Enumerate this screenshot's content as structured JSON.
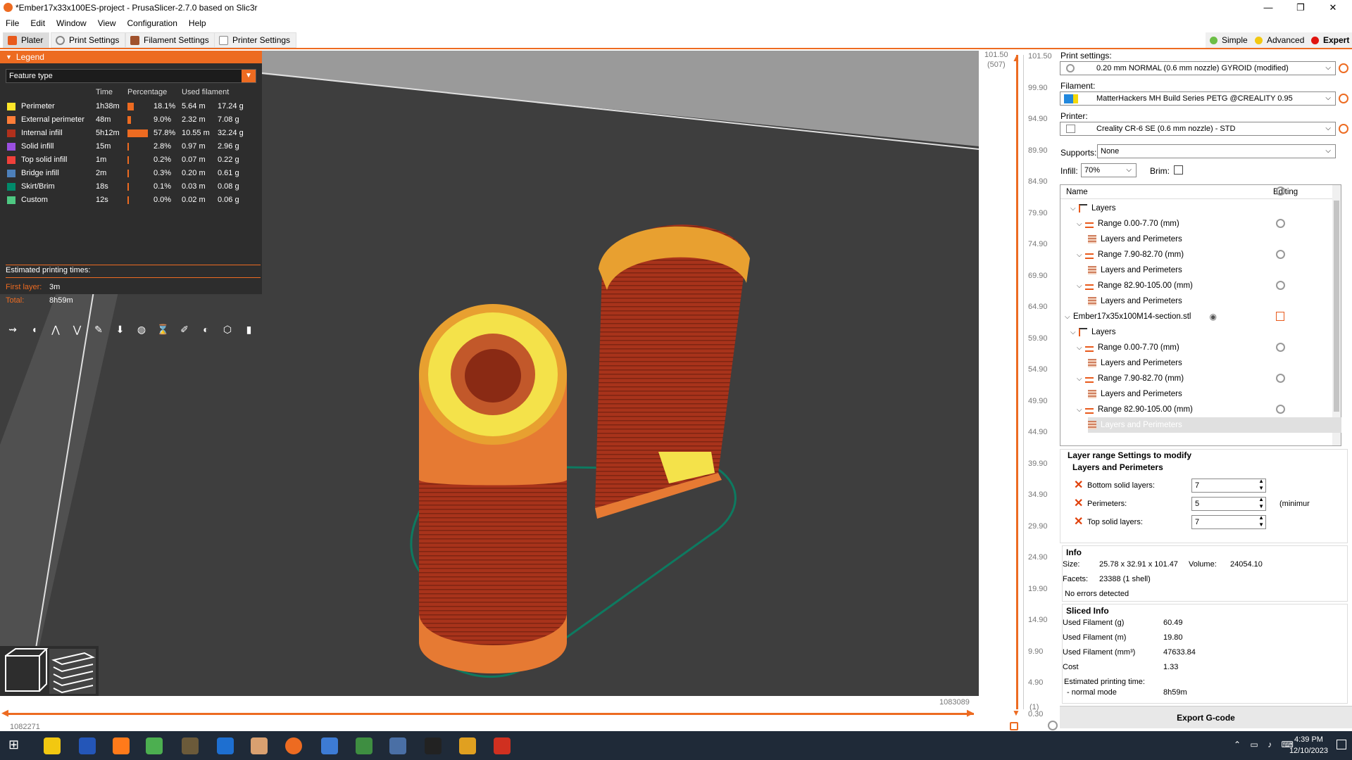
{
  "window": {
    "title": "*Ember17x33x100ES-project - PrusaSlicer-2.7.0 based on Slic3r",
    "minimize": "—",
    "maximize": "❐",
    "close": "✕"
  },
  "menu": [
    "File",
    "Edit",
    "Window",
    "View",
    "Configuration",
    "Help"
  ],
  "tabs": [
    {
      "label": "Plater",
      "icon": "plater-icon"
    },
    {
      "label": "Print Settings",
      "icon": "print-settings-icon"
    },
    {
      "label": "Filament Settings",
      "icon": "filament-icon"
    },
    {
      "label": "Printer Settings",
      "icon": "printer-icon"
    }
  ],
  "modes": [
    {
      "label": "Simple",
      "color": "#6cbe45"
    },
    {
      "label": "Advanced",
      "color": "#f2c811"
    },
    {
      "label": "Expert",
      "color": "#e0140f"
    }
  ],
  "legend": {
    "header": "Legend",
    "view_type": "Feature type",
    "columns": {
      "time": "Time",
      "percentage": "Percentage",
      "used": "Used filament"
    },
    "rows": [
      {
        "name": "Perimeter",
        "time": "1h38m",
        "pct": "18.1%",
        "pct_value": 18.1,
        "len": "5.64 m",
        "weight": "17.24 g",
        "color": "#ffe629"
      },
      {
        "name": "External perimeter",
        "time": "48m",
        "pct": "9.0%",
        "pct_value": 9.0,
        "len": "2.32 m",
        "weight": "7.08 g",
        "color": "#ff7d38"
      },
      {
        "name": "Internal infill",
        "time": "5h12m",
        "pct": "57.8%",
        "pct_value": 57.8,
        "len": "10.55 m",
        "weight": "32.24 g",
        "color": "#b0301c"
      },
      {
        "name": "Solid infill",
        "time": "15m",
        "pct": "2.8%",
        "pct_value": 2.8,
        "len": "0.97 m",
        "weight": "2.96 g",
        "color": "#9a4fe0"
      },
      {
        "name": "Top solid infill",
        "time": "1m",
        "pct": "0.2%",
        "pct_value": 0.2,
        "len": "0.07 m",
        "weight": "0.22 g",
        "color": "#f0403a"
      },
      {
        "name": "Bridge infill",
        "time": "2m",
        "pct": "0.3%",
        "pct_value": 0.3,
        "len": "0.20 m",
        "weight": "0.61 g",
        "color": "#4d80ba"
      },
      {
        "name": "Skirt/Brim",
        "time": "18s",
        "pct": "0.1%",
        "pct_value": 0.1,
        "len": "0.03 m",
        "weight": "0.08 g",
        "color": "#008a6a"
      },
      {
        "name": "Custom",
        "time": "12s",
        "pct": "0.0%",
        "pct_value": 0.0,
        "len": "0.02 m",
        "weight": "0.06 g",
        "color": "#4ec882"
      }
    ],
    "est_label": "Estimated printing times:",
    "first_layer_label": "First layer:",
    "first_layer": "3m",
    "total_label": "Total:",
    "total": "8h59m",
    "view_icons": [
      "travel-icon",
      "wipe-icon",
      "retraction-icon",
      "deretraction-icon",
      "seam-icon",
      "tool-change-icon",
      "color-change-icon",
      "pause-icon",
      "custom-gcode-icon",
      "center-of-gravity-icon",
      "shells-icon",
      "tool-marker-icon"
    ]
  },
  "vslider": {
    "top": "101.50",
    "top_layer": "(507)",
    "bottom": "0.30",
    "bottom_layer": "(1)",
    "ticks": [
      "101.50",
      "99.90",
      "94.90",
      "89.90",
      "84.90",
      "79.90",
      "74.90",
      "69.90",
      "64.90",
      "59.90",
      "54.90",
      "49.90",
      "44.90",
      "39.90",
      "34.90",
      "29.90",
      "24.90",
      "19.90",
      "14.90",
      "9.90",
      "4.90",
      "0.30"
    ]
  },
  "hslider": {
    "left": "1082271",
    "right": "1083089"
  },
  "panel": {
    "print_label": "Print settings:",
    "print_value": "0.20 mm NORMAL (0.6 mm nozzle) GYROID (modified)",
    "filament_label": "Filament:",
    "filament_value": "MatterHackers MH Build Series PETG @CREALITY 0.95",
    "printer_label": "Printer:",
    "printer_value": "Creality CR-6 SE (0.6 mm nozzle) - STD",
    "supports_label": "Supports:",
    "supports_value": "None",
    "infill_label": "Infill:",
    "infill_value": "70%",
    "brim_label": "Brim:"
  },
  "tree": {
    "col_name": "Name",
    "col_editing": "Editing",
    "rows": [
      {
        "label": "Layers",
        "indent": 1,
        "kind": "layers"
      },
      {
        "label": "Range 0.00-7.70 (mm)",
        "indent": 2,
        "kind": "range"
      },
      {
        "label": "Layers and Perimeters",
        "indent": 3,
        "kind": "setting"
      },
      {
        "label": "Range 7.90-82.70 (mm)",
        "indent": 2,
        "kind": "range"
      },
      {
        "label": "Layers and Perimeters",
        "indent": 3,
        "kind": "setting"
      },
      {
        "label": "Range 82.90-105.00 (mm)",
        "indent": 2,
        "kind": "range"
      },
      {
        "label": "Layers and Perimeters",
        "indent": 3,
        "kind": "setting"
      },
      {
        "label": "Ember17x35x100M14-section.stl",
        "indent": 0,
        "kind": "object"
      },
      {
        "label": "Layers",
        "indent": 1,
        "kind": "layers"
      },
      {
        "label": "Range 0.00-7.70 (mm)",
        "indent": 2,
        "kind": "range"
      },
      {
        "label": "Layers and Perimeters",
        "indent": 3,
        "kind": "setting"
      },
      {
        "label": "Range 7.90-82.70 (mm)",
        "indent": 2,
        "kind": "range"
      },
      {
        "label": "Layers and Perimeters",
        "indent": 3,
        "kind": "setting"
      },
      {
        "label": "Range 82.90-105.00 (mm)",
        "indent": 2,
        "kind": "range"
      },
      {
        "label": "Layers and Perimeters",
        "indent": 3,
        "kind": "setting-selected"
      }
    ]
  },
  "layer_settings": {
    "title": "Layer range Settings to modify",
    "subtitle": "Layers and Perimeters",
    "fields": [
      {
        "label": "Bottom solid layers:",
        "value": "7",
        "suffix": ""
      },
      {
        "label": "Perimeters:",
        "value": "5",
        "suffix": "(minimur"
      },
      {
        "label": "Top solid layers:",
        "value": "7",
        "suffix": ""
      }
    ]
  },
  "info": {
    "title": "Info",
    "size_label": "Size:",
    "size": "25.78 x 32.91 x 101.47",
    "volume_label": "Volume:",
    "volume": "24054.10",
    "facets_label": "Facets:",
    "facets": "23388 (1 shell)",
    "errors": "No errors detected"
  },
  "sliced": {
    "title": "Sliced Info",
    "rows": [
      {
        "label": "Used Filament (g)",
        "value": "60.49"
      },
      {
        "label": "Used Filament (m)",
        "value": "19.80"
      },
      {
        "label": "Used Filament (mm³)",
        "value": "47633.84"
      },
      {
        "label": "Cost",
        "value": "1.33"
      }
    ],
    "est_label": "Estimated printing time:",
    "mode_label": "- normal mode",
    "mode_value": "8h59m"
  },
  "export_button": "Export G-code",
  "taskbar": {
    "time": "4:39 PM",
    "date": "12/10/2023",
    "apps": [
      "windows-start-icon",
      "file-explorer-icon",
      "powershell-icon",
      "firefox-icon",
      "notepad-icon",
      "gimp-icon",
      "app-blue-icon",
      "app-circle-icon",
      "prusaslicer-icon",
      "calculator-icon",
      "spreadsheet-icon",
      "editor-icon",
      "terminal-icon",
      "archive-icon",
      "app-flame-icon"
    ],
    "tray": [
      "chevron-up-icon",
      "network-icon",
      "speaker-icon",
      "keyboard-icon"
    ],
    "notification_icon": "notification-icon"
  }
}
